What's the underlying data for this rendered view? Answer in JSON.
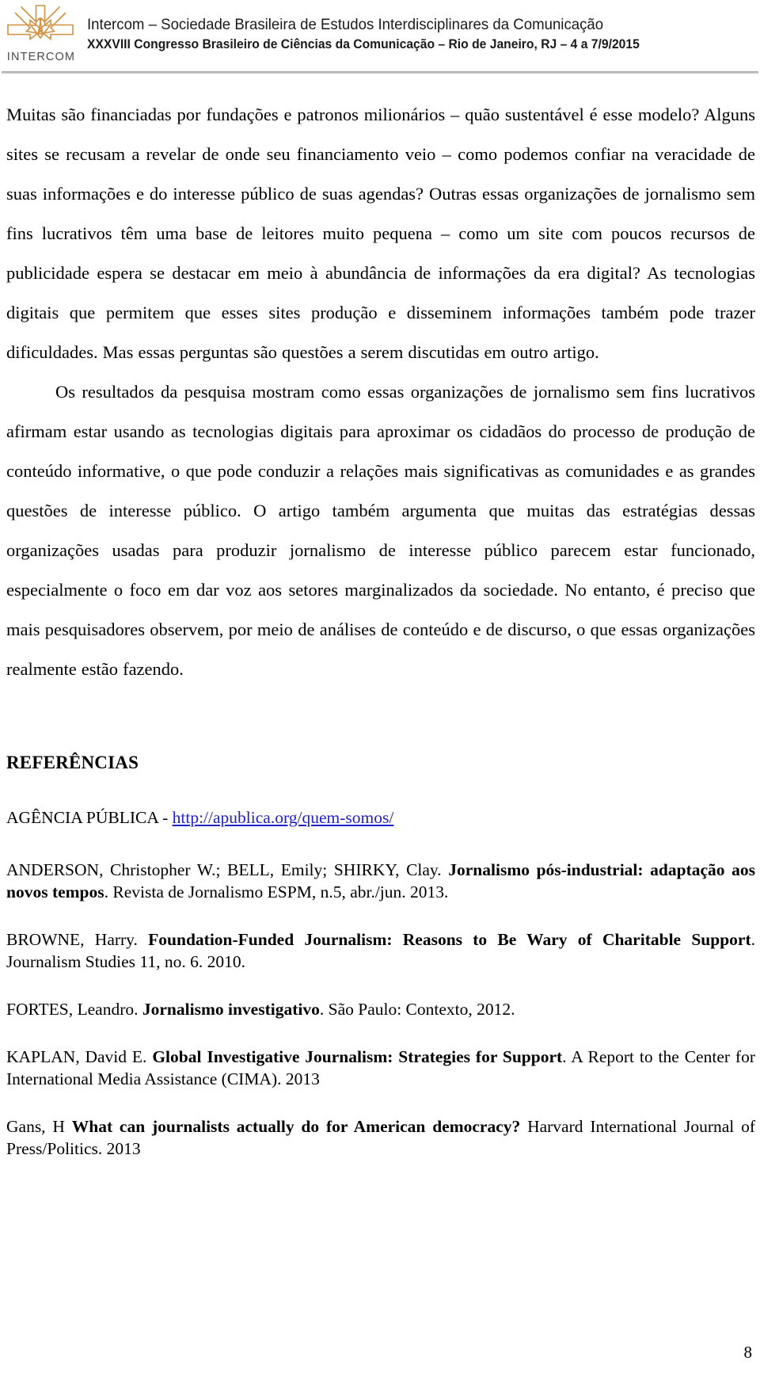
{
  "header": {
    "logo_word": "INTERCOM",
    "logo_color": "#d2913f",
    "line1": "Intercom – Sociedade Brasileira de Estudos Interdisciplinares da Comunicação",
    "line2": "XXXVIII Congresso Brasileiro de Ciências da Comunicação – Rio de Janeiro, RJ – 4 a 7/9/2015",
    "rule_color": "#9b9b9b"
  },
  "body": {
    "paragraph_1": "Muitas são financiadas por fundações e patronos milionários – quão sustentável é esse modelo? Alguns sites se recusam a revelar de onde seu financiamento veio – como podemos confiar na veracidade de suas informações e do interesse público de suas agendas? Outras essas organizações de jornalismo sem fins lucrativos têm uma base de leitores muito pequena – como um site com poucos recursos de publicidade espera se destacar em meio à abundância de informações da era digital? As tecnologias digitais que permitem que esses sites produção e disseminem informações também pode trazer dificuldades. Mas essas perguntas são questões a serem discutidas em outro artigo.",
    "paragraph_2": "Os resultados da pesquisa mostram como essas organizações de jornalismo sem fins lucrativos afirmam estar usando as tecnologias digitais para aproximar os cidadãos do processo de produção de conteúdo informative, o que pode conduzir a relações mais significativas as comunidades e as grandes questões de interesse público. O artigo também argumenta que muitas das estratégias dessas organizações usadas para produzir jornalismo de interesse público parecem estar funcionado, especialmente o foco em dar voz aos setores marginalizados da sociedade. No entanto, é preciso que mais pesquisadores observem, por meio de análises de conteúdo e de discurso, o que essas organizações realmente estão fazendo."
  },
  "references": {
    "heading": "REFERÊNCIAS",
    "items": [
      {
        "prefix": "AGÊNCIA PÚBLICA - ",
        "link_text": "http://apublica.org/quem-somos/",
        "bold": "",
        "suffix": ""
      },
      {
        "prefix": "ANDERSON, Christopher W.; BELL, Emily; SHIRKY, Clay. ",
        "bold": "Jornalismo pós-industrial: adaptação aos novos tempos",
        "suffix": ". Revista de Jornalismo ESPM, n.5, abr./jun. 2013."
      },
      {
        "prefix": "BROWNE, Harry. ",
        "bold": "Foundation-Funded Journalism: Reasons to Be Wary of Charitable Support",
        "suffix": ". Journalism Studies 11, no. 6. 2010."
      },
      {
        "prefix": "FORTES, Leandro. ",
        "bold": "Jornalismo investigativo",
        "suffix": ". São Paulo: Contexto, 2012."
      },
      {
        "prefix": "KAPLAN, David E. ",
        "bold": "Global Investigative Journalism: Strategies for Support",
        "suffix": ". A Report to the Center for International Media Assistance (CIMA). 2013"
      },
      {
        "prefix": "Gans, H  ",
        "bold": "What can journalists actually do for American democracy?",
        "suffix": " Harvard International Journal of Press/Politics. 2013"
      }
    ]
  },
  "footer": {
    "page_number": "8"
  }
}
